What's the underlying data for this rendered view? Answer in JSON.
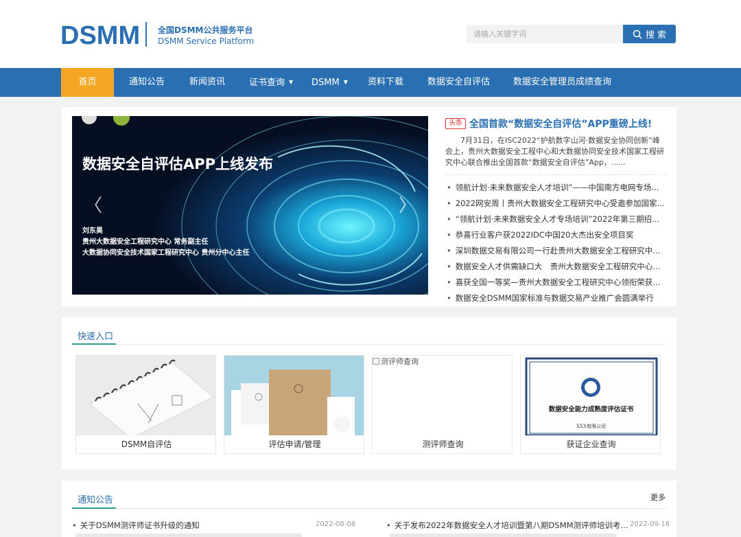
{
  "header": {
    "logo_text": "DSMM",
    "platform_cn": "全国DSMM公共服务平台",
    "platform_en": "DSMM Service Platform",
    "search_placeholder": "请输入关键字词",
    "search_button": "搜 索"
  },
  "nav": {
    "items": [
      {
        "label": "首页",
        "active": true
      },
      {
        "label": "通知公告"
      },
      {
        "label": "新闻资讯"
      },
      {
        "label": "证书查询",
        "dropdown": true
      },
      {
        "label": "DSMM",
        "dropdown": true
      },
      {
        "label": "资料下载"
      },
      {
        "label": "数据安全自评估"
      },
      {
        "label": "数据安全管理员成绩查询"
      }
    ]
  },
  "slider": {
    "title": "数据安全自评估APP上线发布",
    "person_name": "刘东昊",
    "person_line1": "贵州大数据安全工程研究中心 常务副主任",
    "person_line2": "大数据协同安全技术国家工程研究中心 贵州分中心主任",
    "prev_symbol": "〈",
    "next_symbol": "〉"
  },
  "headline": {
    "tag": "头条",
    "title": "全国首款“数据安全自评估”APP重磅上线!",
    "summary": "7月31日，在ISC2022“护航数字山河·数据安全协同创新”峰会上，贵州大数据安全工程中心和大数据协同安全技术国家工程研究中心联合推出全国首款“数据安全自评估”App，......"
  },
  "news": [
    "领航计划·未来数据安全人才培训”——中国南方电网专场...",
    "2022网安周丨贵州大数据安全工程研究中心受邀参加国家...",
    "“领航计划·未来数据安全人才专场培训”2022年第三期招...",
    "恭喜行业客户获2022IDC中国20大杰出安全项目奖",
    "深圳数据交易有限公司一行赴贵州大数据安全工程研究中...",
    "数据安全人才供需缺口大　贵州大数据安全工程研究中心...",
    "喜获全国一等奖—贵州大数据安全工程研究中心领衔荣获...",
    "数据安全DSMM国家标准与数据交易产业推广会圆满举行"
  ],
  "quick": {
    "title": "快速入口",
    "tiles": [
      {
        "label": "DSMM自评估"
      },
      {
        "label": "评估申请/管理"
      },
      {
        "label": "测评师查询",
        "broken_alt": "测评师查询"
      },
      {
        "label": "获证企业查询",
        "cert_title": "数据安全能力成熟度评估证书",
        "cert_company": "XXX有限公司"
      }
    ]
  },
  "notices": {
    "title": "通知公告",
    "more": "更多",
    "items": [
      {
        "text": "关于DSMM测评师证书升级的通知",
        "date": "2022-08-08"
      },
      {
        "text": "关于发布2022年数据安全人才培训暨第八期DSMM测评师培训考...",
        "date": "2022-09-16"
      }
    ]
  },
  "colors": {
    "brand_blue": "#2a6fb1",
    "active_orange": "#f5a623",
    "section_teal": "#2a9d8f",
    "headline_tag_red": "#dd3333"
  }
}
